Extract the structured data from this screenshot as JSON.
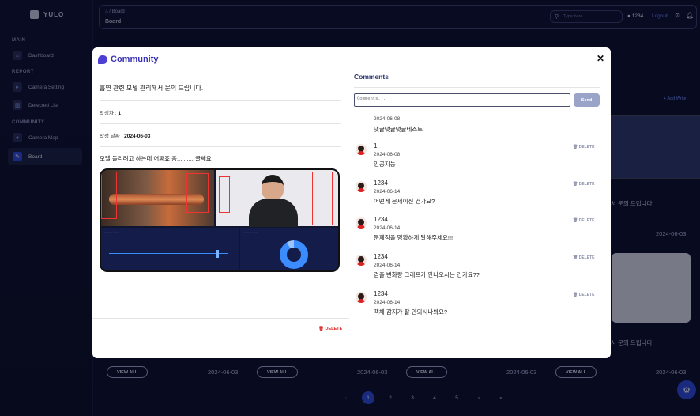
{
  "app": {
    "brand": "YULO"
  },
  "sidebar": {
    "sections": [
      {
        "label": "MAIN"
      },
      {
        "label": "REPORT"
      },
      {
        "label": "COMMUNITY"
      }
    ],
    "items": [
      {
        "label": "Dashboard",
        "icon": "dashboard-icon"
      },
      {
        "label": "Camera Setting",
        "icon": "camera-icon"
      },
      {
        "label": "Detected List",
        "icon": "chart-icon"
      },
      {
        "label": "Camera Map",
        "icon": "map-icon"
      },
      {
        "label": "Board",
        "icon": "pencil-icon",
        "active": true
      }
    ]
  },
  "topbar": {
    "breadcrumb": "Board",
    "title": "Board",
    "search_placeholder": "Type here...",
    "user": "1234",
    "logout": "Logout"
  },
  "background": {
    "add_write": "+ Add Write",
    "view_all": "VIEW ALL",
    "dates": [
      "2024-06-03",
      "2024-06-03",
      "2024-06-03",
      "2024-06-03",
      "2024-06-03"
    ],
    "snippets": [
      "서 문의 드립니다.",
      "서 문의 드립니다."
    ],
    "pagination": [
      "‹",
      "1",
      "2",
      "3",
      "4",
      "5",
      "›",
      "»"
    ]
  },
  "modal": {
    "title": "Community",
    "post": {
      "title": "흡연 관련 모델 관리해서 문의 드립니다.",
      "author_label": "작성자 : ",
      "author": "1",
      "date_label": "작성 날짜 : ",
      "date": "2024-06-03",
      "body": "모델 돌리려고 하는데 어쩌죠 음.......... 글쎄요",
      "delete": "DELETE"
    },
    "comments": {
      "title": "Comments",
      "placeholder": "Comments...",
      "send": "Send",
      "delete": "DELETE",
      "items": [
        {
          "user": "",
          "date": "2024-06-08",
          "text": "댓글댓글댓글테스트"
        },
        {
          "user": "1",
          "date": "2024-06-08",
          "text": "인공지능"
        },
        {
          "user": "1234",
          "date": "2024-06-14",
          "text": "어떤게 문제이신 건가요?"
        },
        {
          "user": "1234",
          "date": "2024-06-14",
          "text": "문제점을 명확하게 말해주세요!!!"
        },
        {
          "user": "1234",
          "date": "2024-06-14",
          "text": "검출 변화량 그래프가 안나오시는 건가요??"
        },
        {
          "user": "1234",
          "date": "2024-06-14",
          "text": "객체 감지가 잘 안되시나봐요?"
        }
      ]
    }
  }
}
